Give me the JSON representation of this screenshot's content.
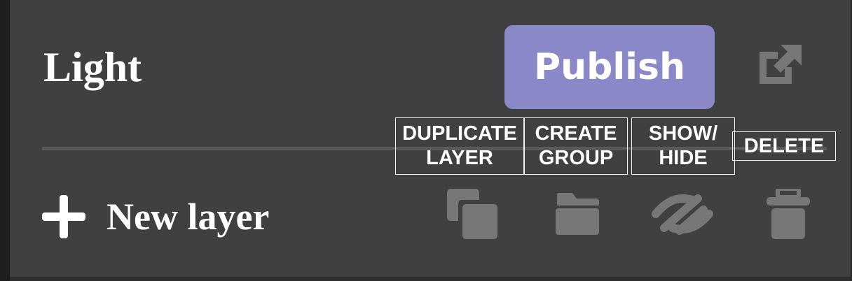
{
  "header": {
    "title": "Light",
    "publish_label": "Publish",
    "external_icon": "external-link-icon"
  },
  "layers": {
    "new_layer_label": "New layer",
    "new_layer_icon": "plus-icon"
  },
  "toolbar": {
    "buttons": [
      {
        "icon": "duplicate-icon",
        "label": "DUPLICATE\nLAYER"
      },
      {
        "icon": "folder-icon",
        "label": "CREATE\nGROUP"
      },
      {
        "icon": "eye-slash-icon",
        "label": "SHOW/\nHIDE"
      },
      {
        "icon": "trash-icon",
        "label": "DELETE"
      }
    ]
  },
  "colors": {
    "panel_bg": "#404040",
    "accent": "#8a88c8",
    "icon_gray": "#777777",
    "text": "#ffffff"
  }
}
